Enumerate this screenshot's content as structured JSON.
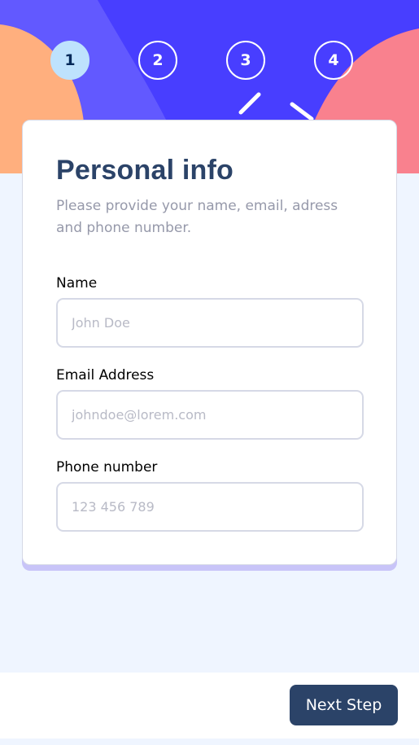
{
  "colors": {
    "banner_purple": "#483eff",
    "banner_light_purple": "#6259ff",
    "banner_orange": "#ffaf7e",
    "banner_pink": "#f9818e",
    "active_step_bg": "#bee2fd",
    "heading": "#2b4368",
    "muted_text": "#9699aa",
    "button_bg": "#2b4368",
    "page_bg": "#eff5ff"
  },
  "steps": [
    {
      "number": "1",
      "active": true
    },
    {
      "number": "2",
      "active": false
    },
    {
      "number": "3",
      "active": false
    },
    {
      "number": "4",
      "active": false
    }
  ],
  "form": {
    "title": "Personal info",
    "subtitle": "Please provide your name, email, adress and phone number.",
    "fields": [
      {
        "label": "Name",
        "placeholder": "John Doe",
        "value": ""
      },
      {
        "label": "Email Address",
        "placeholder": "johndoe@lorem.com",
        "value": ""
      },
      {
        "label": "Phone number",
        "placeholder": "123 456 789",
        "value": ""
      }
    ]
  },
  "footer": {
    "next_label": "Next Step"
  }
}
